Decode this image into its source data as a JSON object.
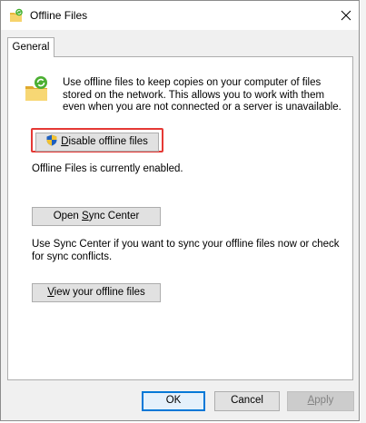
{
  "window": {
    "title": "Offline Files"
  },
  "tabs": [
    {
      "label": "General",
      "active": true
    }
  ],
  "general": {
    "description": "Use offline files to keep copies on your computer of files stored on the network.  This allows you to work with them even when you are not connected or a server is unavailable.",
    "disable_button": {
      "mnemonic": "D",
      "rest": "isable offline files",
      "requires_admin": true
    },
    "status": "Offline Files is currently enabled.",
    "sync_button": {
      "before": "Open ",
      "mnemonic": "S",
      "rest": "ync Center"
    },
    "sync_description": "Use Sync Center if you want to sync your offline files now or check for sync conflicts.",
    "view_button": {
      "mnemonic": "V",
      "rest": "iew your offline files"
    }
  },
  "footer": {
    "ok_label": "OK",
    "cancel_label": "Cancel",
    "apply": {
      "mnemonic": "A",
      "rest": "pply",
      "disabled": true
    }
  },
  "colors": {
    "highlight": "#e53935",
    "default_button_border": "#0078d7"
  },
  "icons": {
    "app": "offline-files-icon",
    "shield": "uac-shield-icon",
    "close": "close-icon"
  }
}
